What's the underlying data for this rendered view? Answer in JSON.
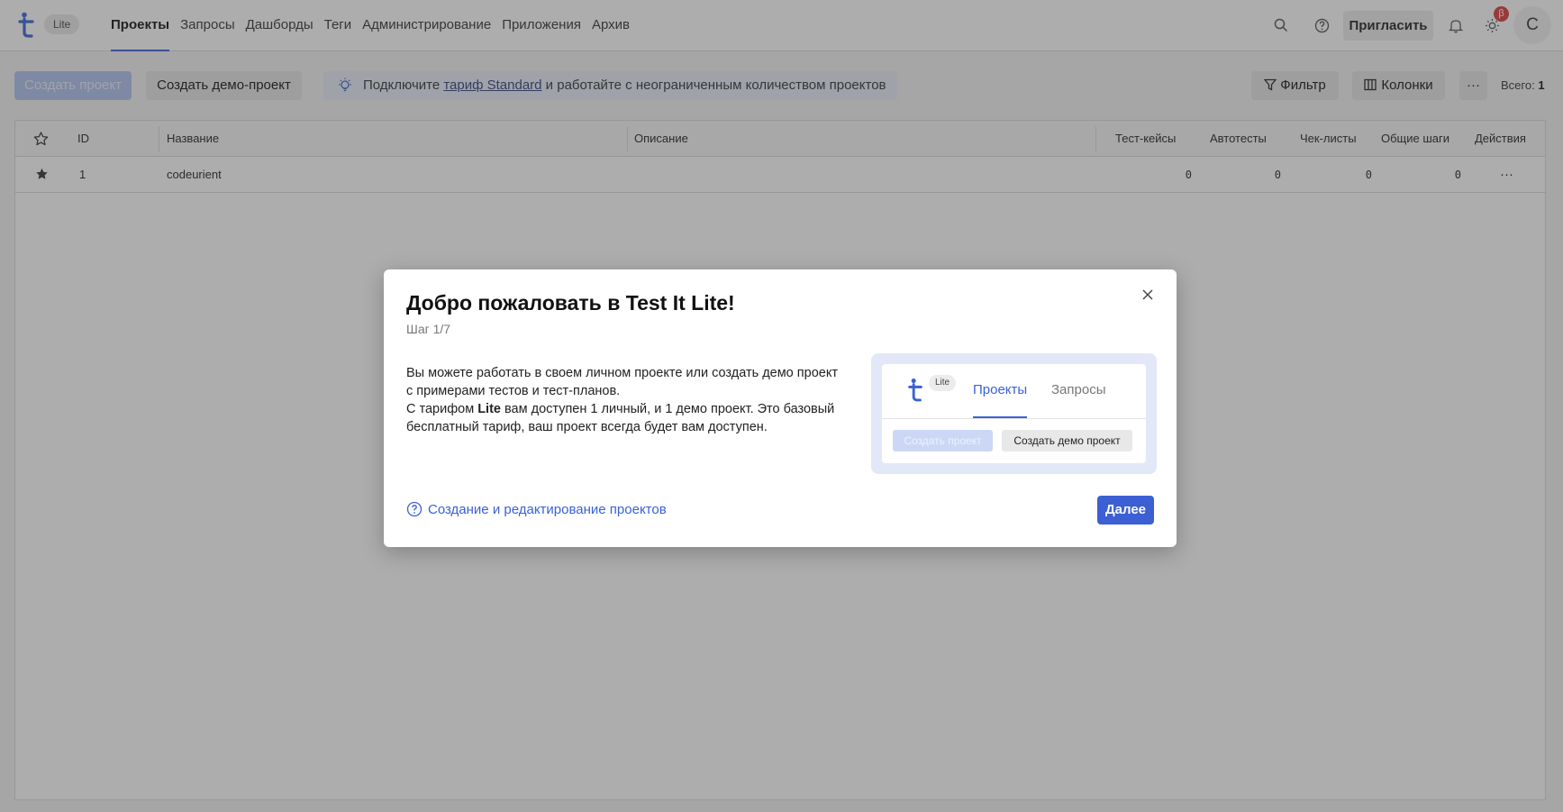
{
  "app": {
    "logo_icon": "testit-logo-icon",
    "plan_badge": "Lite",
    "nav": [
      {
        "label": "Проекты",
        "active": true
      },
      {
        "label": "Запросы"
      },
      {
        "label": "Дашборды"
      },
      {
        "label": "Теги"
      },
      {
        "label": "Администрирование"
      },
      {
        "label": "Приложения"
      },
      {
        "label": "Архив"
      }
    ],
    "invite_label": "Пригласить",
    "beta_badge": "β",
    "avatar_letter": "C",
    "accent_color": "#3a61d6"
  },
  "toolbar": {
    "create_label": "Создать проект",
    "demo_label": "Создать демо-проект",
    "promo_prefix": "Подключите ",
    "promo_link": "тариф Standard",
    "promo_suffix": " и работайте с неограниченным количеством проектов",
    "filter_label": "Фильтр",
    "columns_label": "Колонки",
    "more_label": "···",
    "total_label": "Всего: ",
    "total_value": "1"
  },
  "table": {
    "headers": {
      "id": "ID",
      "name": "Название",
      "description": "Описание",
      "testcases": "Тест-кейсы",
      "autotests": "Автотесты",
      "checklists": "Чек-листы",
      "shared_steps": "Общие шаги",
      "actions": "Действия"
    },
    "rows": [
      {
        "favorite": true,
        "id": "1",
        "name": "codeurient",
        "description": "",
        "testcases": "0",
        "autotests": "0",
        "checklists": "0",
        "shared_steps": "0",
        "actions": "···"
      }
    ]
  },
  "modal": {
    "title": "Добро пожаловать в Test It Lite!",
    "step": "Шаг 1/7",
    "text_line1": "Вы можете работать в своем личном проекте или создать демо проект с примерами тестов и тест-планов.",
    "text_line2_prefix": "С тарифом ",
    "text_line2_bold": "Lite",
    "text_line2_suffix": " вам доступен 1 личный, и 1 демо проект. Это базовый бесплатный тариф, ваш проект всегда будет вам доступен.",
    "preview": {
      "lite_badge": "Lite",
      "tab_active": "Проекты",
      "tab_other": "Запросы",
      "btn_create": "Создать проект",
      "btn_demo": "Создать демо проект"
    },
    "help_link": "Создание и редактирование проектов",
    "next_label": "Далее"
  }
}
